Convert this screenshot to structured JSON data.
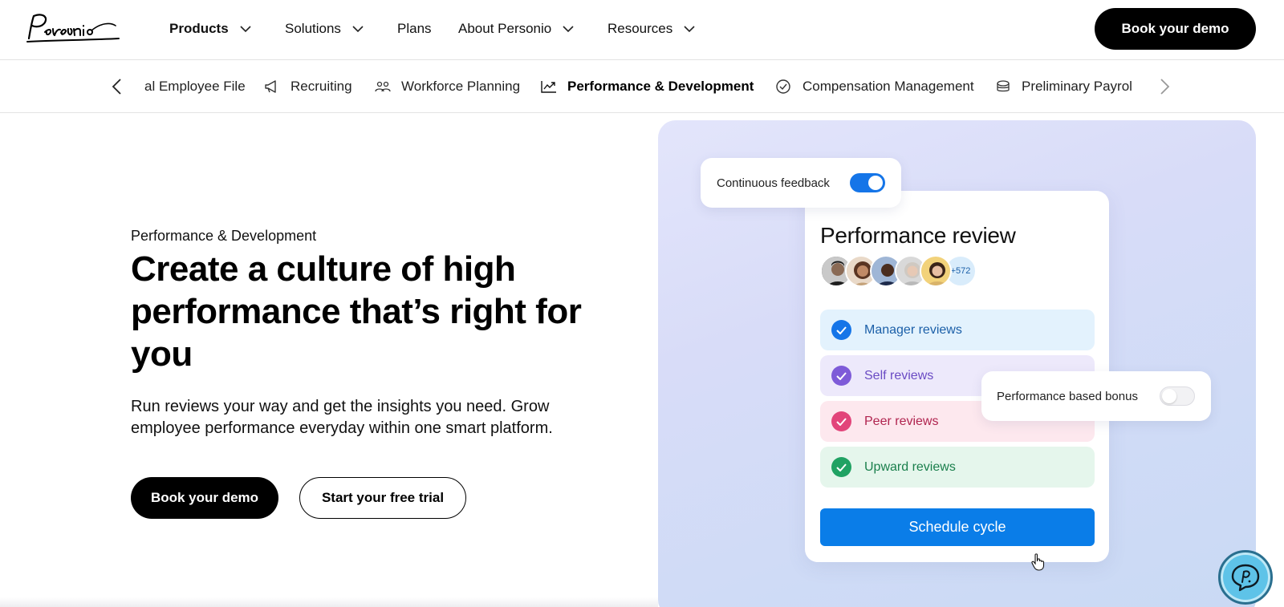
{
  "brand": {
    "logo_text": "Personio"
  },
  "topnav": {
    "items": [
      {
        "label": "Products",
        "has_dropdown": true,
        "active": true
      },
      {
        "label": "Solutions",
        "has_dropdown": true
      },
      {
        "label": "Plans",
        "has_dropdown": false
      },
      {
        "label": "About Personio",
        "has_dropdown": true
      },
      {
        "label": "Resources",
        "has_dropdown": true
      }
    ],
    "cta_label": "Book your demo"
  },
  "subnav": {
    "items": [
      {
        "label": "Digital Employee File",
        "icon": "folder-icon",
        "visible_label": "al Employee File"
      },
      {
        "label": "Recruiting",
        "icon": "megaphone-icon"
      },
      {
        "label": "Workforce Planning",
        "icon": "people-icon"
      },
      {
        "label": "Performance & Development",
        "icon": "trend-chart-icon",
        "active": true
      },
      {
        "label": "Compensation Management",
        "icon": "check-circle-icon"
      },
      {
        "label": "Preliminary Payroll",
        "icon": "coins-icon"
      }
    ]
  },
  "hero": {
    "eyebrow": "Performance & Development",
    "headline": "Create a culture of high performance that’s right for you",
    "subtext": "Run reviews your way and get the insights you need. Grow employee performance everyday within one smart platform.",
    "primary_cta": "Book your demo",
    "secondary_cta": "Start your free trial"
  },
  "illustration": {
    "feedback_label": "Continuous feedback",
    "feedback_enabled": true,
    "review_title": "Performance review",
    "participants_more": "+572",
    "rows": [
      {
        "label": "Manager reviews",
        "bg": "#e3f2fd",
        "check": "#1575e8",
        "text": "#1b5fa8"
      },
      {
        "label": "Self reviews",
        "bg": "#ede9fb",
        "check": "#7e5bd8",
        "text": "#6a4bc4"
      },
      {
        "label": "Peer reviews",
        "bg": "#fde8ee",
        "check": "#e2457a",
        "text": "#b0244f"
      },
      {
        "label": "Upward reviews",
        "bg": "#e5f6ec",
        "check": "#20a263",
        "text": "#1a7f4c"
      }
    ],
    "schedule_label": "Schedule cycle",
    "bonus_label": "Performance based bonus",
    "bonus_enabled": false
  },
  "colors": {
    "accent_blue": "#0a7de8",
    "black": "#000000"
  }
}
